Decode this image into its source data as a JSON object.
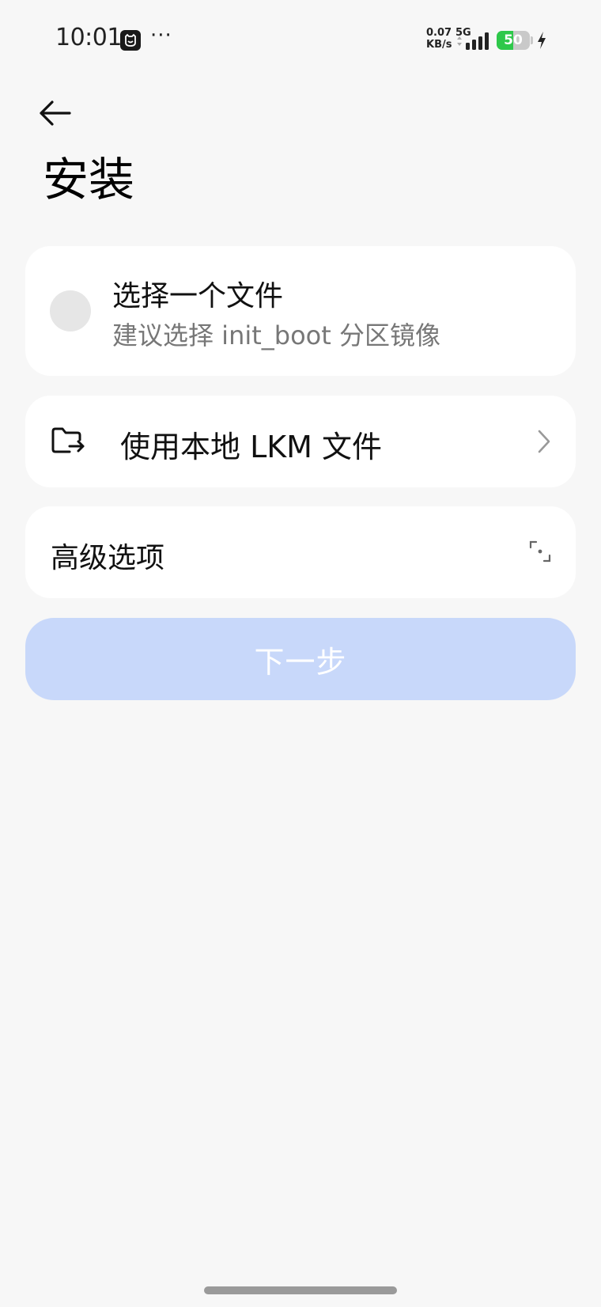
{
  "status_bar": {
    "time": "10:01",
    "overflow": "···",
    "net_speed_value": "0.07",
    "net_speed_unit": "KB/s",
    "network_type": "5G",
    "battery_level": "50",
    "battery_fraction": 0.5,
    "battery_color": "#2ec84a",
    "icons": [
      "app-notification-icon",
      "signal-icon",
      "battery-icon",
      "charging-icon"
    ]
  },
  "header": {
    "back_icon": "arrow-left-icon",
    "title": "安装"
  },
  "select_file": {
    "title": "选择一个文件",
    "subtitle": "建议选择 init_boot 分区镜像",
    "selected": false
  },
  "lkm": {
    "icon": "folder-import-icon",
    "label": "使用本地 LKM 文件",
    "trailing_icon": "chevron-right-icon"
  },
  "advanced": {
    "label": "高级选项",
    "trailing_icon": "expand-icon"
  },
  "next_button": {
    "label": "下一步",
    "enabled": false,
    "color": "#c8d8fa"
  }
}
